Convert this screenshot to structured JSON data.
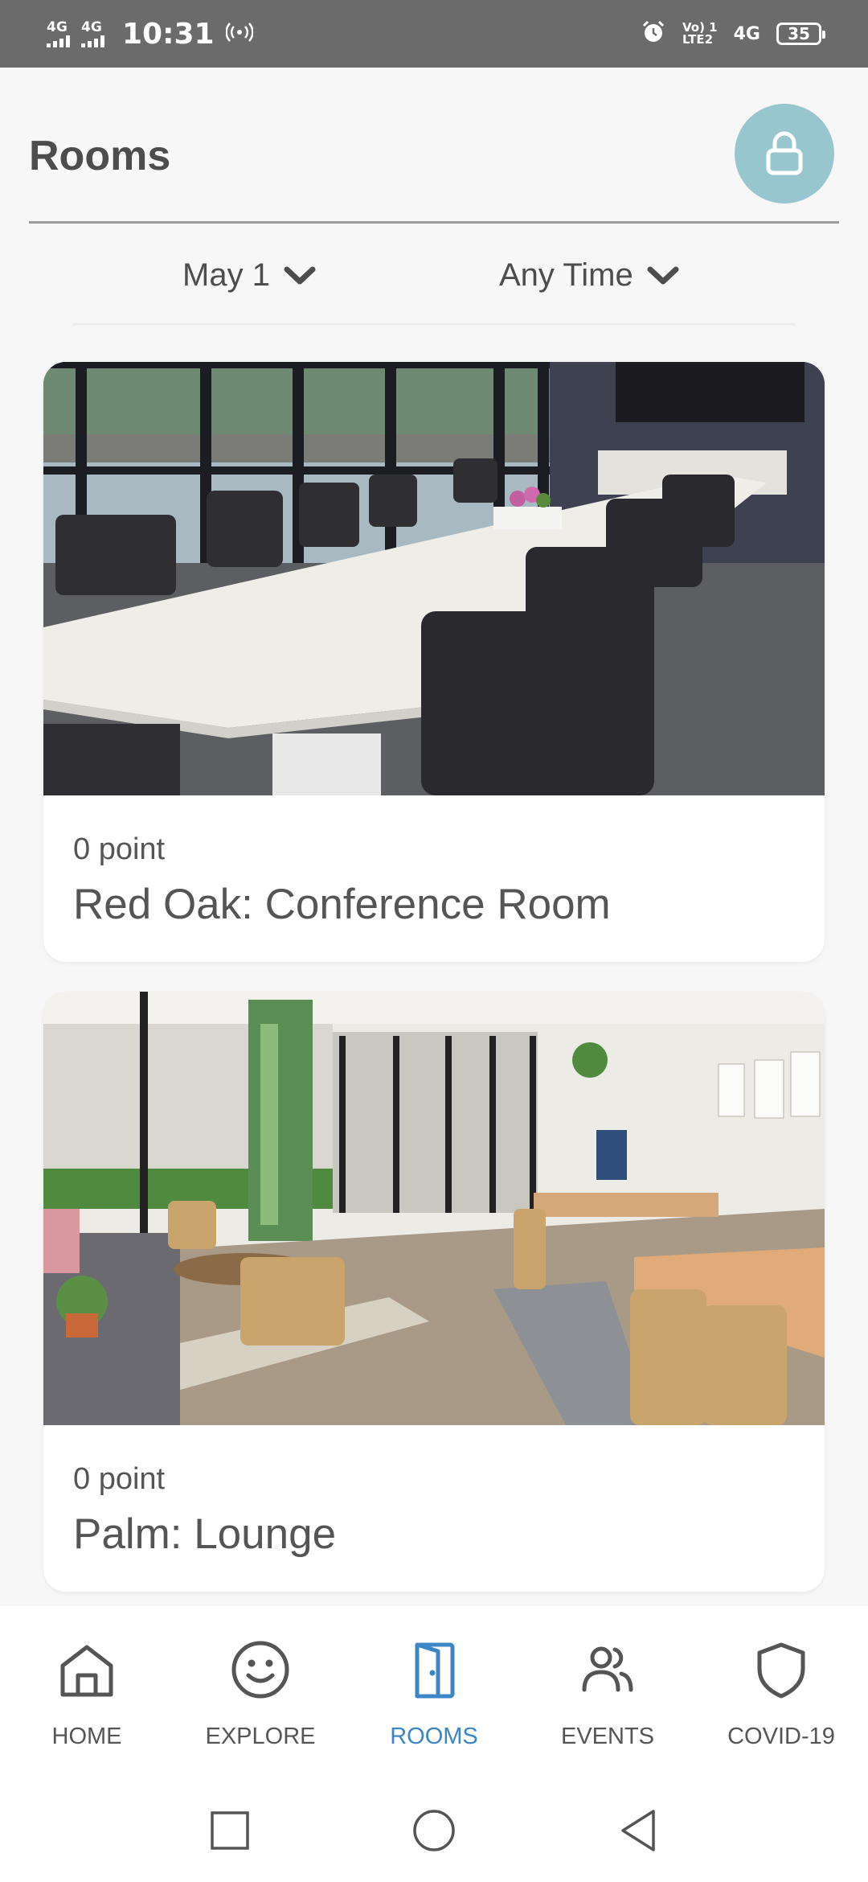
{
  "status_bar": {
    "network_1": "4G",
    "network_2": "4G",
    "time": "10:31",
    "volte_label": "Vo) 1\nLTE2",
    "network_3": "4G",
    "battery": "35"
  },
  "header": {
    "title": "Rooms"
  },
  "filters": {
    "date_label": "May 1",
    "time_label": "Any Time"
  },
  "rooms": [
    {
      "points": "0 point",
      "name": "Red Oak: Conference Room"
    },
    {
      "points": "0 point",
      "name": "Palm: Lounge"
    }
  ],
  "bottom_nav": {
    "items": [
      {
        "label": "HOME",
        "icon": "home-icon"
      },
      {
        "label": "EXPLORE",
        "icon": "smiley-icon"
      },
      {
        "label": "ROOMS",
        "icon": "door-icon",
        "active": true
      },
      {
        "label": "EVENTS",
        "icon": "people-icon"
      },
      {
        "label": "COVID-19",
        "icon": "shield-icon"
      }
    ]
  },
  "colors": {
    "accent": "#3d86c6",
    "lock_button": "#97c6cf",
    "status_bar": "#6b6b6b"
  }
}
